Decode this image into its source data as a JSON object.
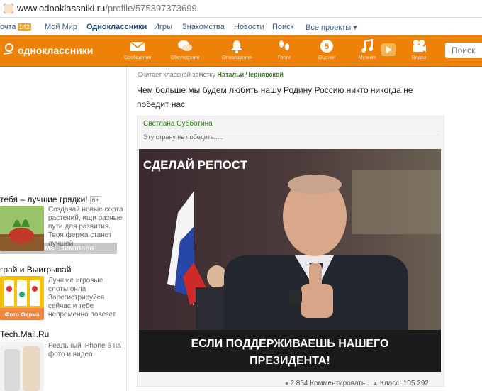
{
  "browser": {
    "url_host": "www.odnoklassniki.ru",
    "url_path": "/profile/575397373699"
  },
  "topnav": {
    "mail_label": "очта",
    "mail_count": "142",
    "items": [
      "Мой Мир",
      "Одноклассники",
      "Игры",
      "Знакомства",
      "Новости",
      "Поиск",
      "Все проекты ▾"
    ]
  },
  "header": {
    "brand": "одноклассники",
    "icons": [
      {
        "label": "Сообщения",
        "icon": "envelope-icon"
      },
      {
        "label": "Обсуждения",
        "icon": "chat-bubbles-icon"
      },
      {
        "label": "Оповещения",
        "icon": "bell-icon"
      },
      {
        "label": "Гости",
        "icon": "footprints-icon"
      },
      {
        "label": "Оценки",
        "icon": "rating-5-icon"
      },
      {
        "label": "Музыка",
        "icon": "music-note-icon"
      },
      {
        "label": "Видео",
        "icon": "video-camera-icon"
      }
    ],
    "search_placeholder": "Поиск",
    "accent": "#ee8208"
  },
  "sidebar": {
    "ad_header": "Реклама: Николаев",
    "ads": [
      {
        "title": "тебя – лучшие грядки!",
        "badge": "6+",
        "text": "Создавай новые сорта растений, ищи разные пути для развития. Твоя ферма станет лучшей"
      },
      {
        "title": "грай и Выигрывай",
        "text": "Лучшие игровые слоты онла Зарегистрируйся сейчас и тебе непременно повезет",
        "img_label": "Фото Ферма"
      },
      {
        "title": "Tech.Mail.Ru",
        "text": "Реальный iPhone 6 на фото и видео"
      }
    ]
  },
  "post": {
    "meta_prefix": "Считает классной заметку",
    "meta_who": "Натальи Чернявской",
    "note_text": "Чем больше мы будем любить нашу Родину Россию никто никогда не победит нас",
    "shared_author": "Светлана Субботина",
    "shared_quote": "Эту страну не победить.....",
    "image_top_caption": "СДЕЛАЙ РЕПОСТ",
    "image_bottom_caption": "ЕСЛИ ПОДДЕРЖИВАЕШЬ НАШЕГО ПРЕЗИДЕНТА!",
    "comments": "2 854 Комментировать",
    "likes": "Класс! 105 292"
  }
}
